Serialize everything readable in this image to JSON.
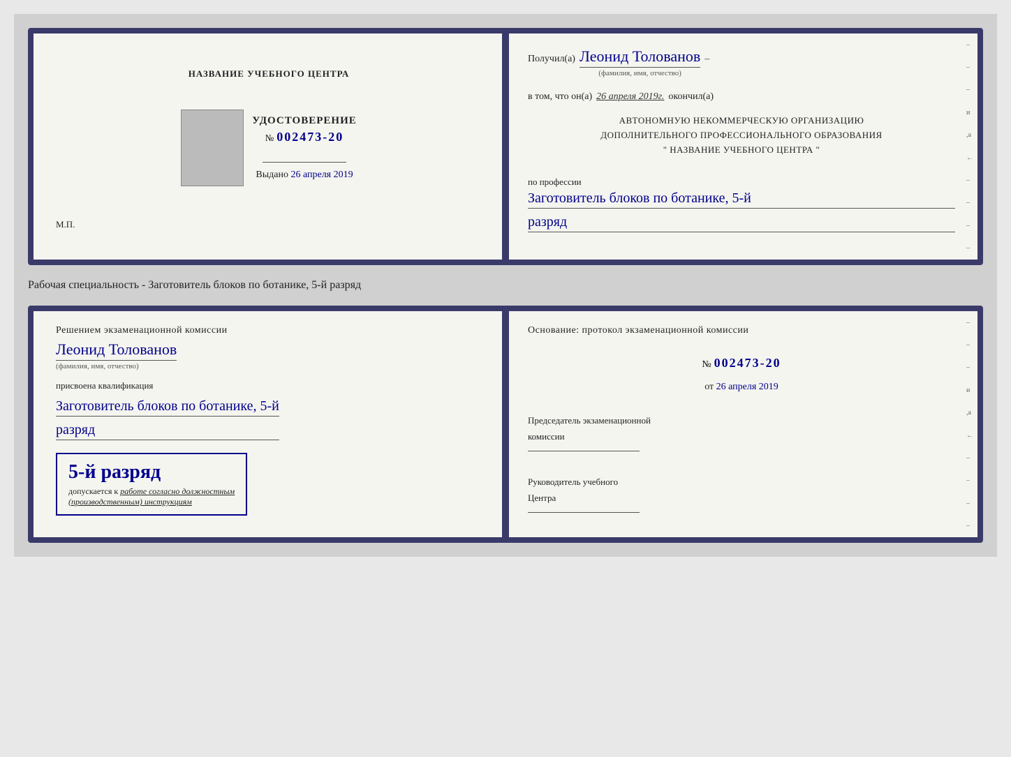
{
  "page": {
    "specialty_label": "Рабочая специальность - Заготовитель блоков по ботанике, 5-й разряд"
  },
  "card1": {
    "left": {
      "center_name": "НАЗВАНИЕ УЧЕБНОГО ЦЕНТРА",
      "cert_title": "УДОСТОВЕРЕНИЕ",
      "cert_number_prefix": "№",
      "cert_number": "002473-20",
      "issued_label": "Выдано",
      "issued_date": "26 апреля 2019",
      "mp_label": "М.П."
    },
    "right": {
      "received_label": "Получил(а)",
      "recipient_name": "Леонид Толованов",
      "fio_label": "(фамилия, имя, отчество)",
      "completed_prefix": "в том, что он(а)",
      "completed_date": "26 апреля 2019г.",
      "completed_suffix": "окончил(а)",
      "org_line1": "АВТОНОМНУЮ НЕКОММЕРЧЕСКУЮ ОРГАНИЗАЦИЮ",
      "org_line2": "ДОПОЛНИТЕЛЬНОГО ПРОФЕССИОНАЛЬНОГО ОБРАЗОВАНИЯ",
      "org_line3": "\"  НАЗВАНИЕ УЧЕБНОГО ЦЕНТРА  \"",
      "profession_label": "по профессии",
      "profession_value": "Заготовитель блоков по ботанике, 5-й",
      "rank_value": "разряд"
    }
  },
  "card2": {
    "left": {
      "decision_text": "Решением экзаменационной комиссии",
      "person_name": "Леонид Толованов",
      "fio_label": "(фамилия, имя, отчество)",
      "assigned_label": "присвоена квалификация",
      "qualification": "Заготовитель блоков по ботанике, 5-й",
      "rank_line": "разряд",
      "badge_main": "5-й разряд",
      "badge_allowed_prefix": "допускается к",
      "badge_allowed_text": "работе согласно должностным",
      "badge_allowed_text2": "(производственным) инструкциям"
    },
    "right": {
      "basis_label": "Основание: протокол экзаменационной комиссии",
      "protocol_prefix": "№",
      "protocol_number": "002473-20",
      "from_label": "от",
      "from_date": "26 апреля 2019",
      "chairman_label": "Председатель экзаменационной",
      "chairman_label2": "комиссии",
      "head_label": "Руководитель учебного",
      "head_label2": "Центра"
    }
  },
  "side_marks": [
    "-",
    "-",
    "-",
    "и",
    ",а",
    "←",
    "-",
    "-",
    "-",
    "-",
    "-"
  ]
}
